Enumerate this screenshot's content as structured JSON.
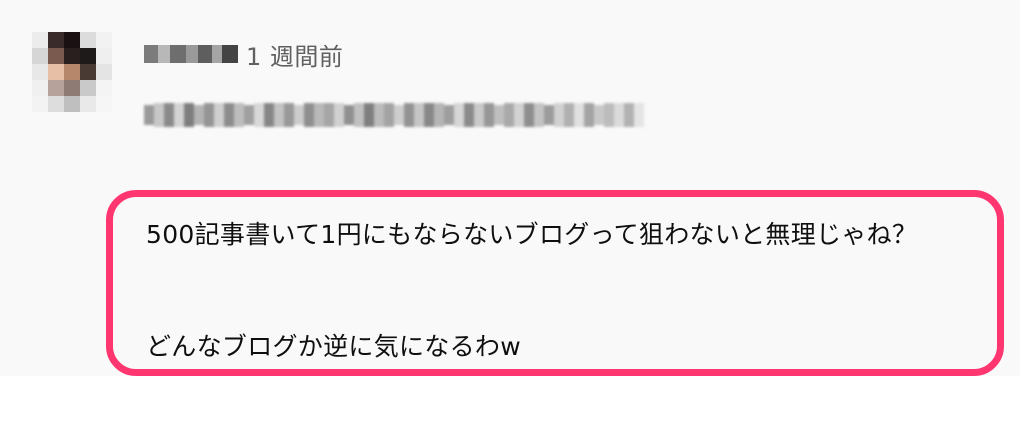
{
  "comment": {
    "author_name_redacted": true,
    "timestamp": "1 週間前",
    "redacted_line": true,
    "text_lines": [
      "500記事書いて1円にもならないブログって狙わないと無理じゃね？",
      "どんなブログか逆に気になるわw"
    ]
  },
  "colors": {
    "highlight_border": "#ff3670",
    "card_background": "#f9f9f9",
    "timestamp_color": "#606060",
    "text_color": "#0f0f0f"
  },
  "avatar": {
    "style": "pixelated",
    "pixels": [
      "#ececec",
      "#3a2b2b",
      "#1a1212",
      "#dcdcdc",
      "#f2f2f2",
      "#d6d6d6",
      "#7a5a4e",
      "#2a1f1f",
      "#1e1a1a",
      "#efefef",
      "#e8e8e8",
      "#e6bfa6",
      "#b7876c",
      "#4a3a34",
      "#e4e4e4",
      "#f0f0f0",
      "#b6a29a",
      "#8d7b74",
      "#c9c9c9",
      "#f4f4f4",
      "#f3f3f3",
      "#dddddd",
      "#bfbfbf",
      "#e9e9e9",
      "#f6f6f6"
    ]
  },
  "blur_blocks": {
    "username": [
      "#7c7c7c",
      "#b8b8b8",
      "#6e6e6e",
      "#9a9a9a",
      "#5e5e5e",
      "#a5a5a5",
      "#444444"
    ],
    "line": [
      "#9a9a9a",
      "#c7c7c7",
      "#8a8a8a",
      "#d3d3d3",
      "#7e7e7e",
      "#b3b3b3",
      "#959595",
      "#cfcfcf",
      "#8c8c8c",
      "#bdbdbd",
      "#a0a0a0",
      "#d8d8d8",
      "#868686",
      "#c2c2c2",
      "#999999",
      "#cccccc",
      "#8f8f8f",
      "#b9b9b9",
      "#a6a6a6",
      "#d0d0d0",
      "#909090",
      "#c0c0c0",
      "#7f7f7f",
      "#bbbbbb",
      "#a3a3a3",
      "#cdcdcd",
      "#939393",
      "#c5c5c5",
      "#888888",
      "#b5b5b5",
      "#9e9e9e",
      "#d6d6d6",
      "#8b8b8b",
      "#c9c9c9",
      "#979797",
      "#bfbfbf",
      "#a9a9a9",
      "#d2d2d2",
      "#8e8e8e",
      "#c3c3c3",
      "#9c9c9c",
      "#d1d1d1",
      "#b0b0b0",
      "#e0e0e0",
      "#a4a4a4",
      "#c8c8c8",
      "#bcbcbc",
      "#dadada",
      "#b2b2b2",
      "#e4e4e4"
    ]
  }
}
